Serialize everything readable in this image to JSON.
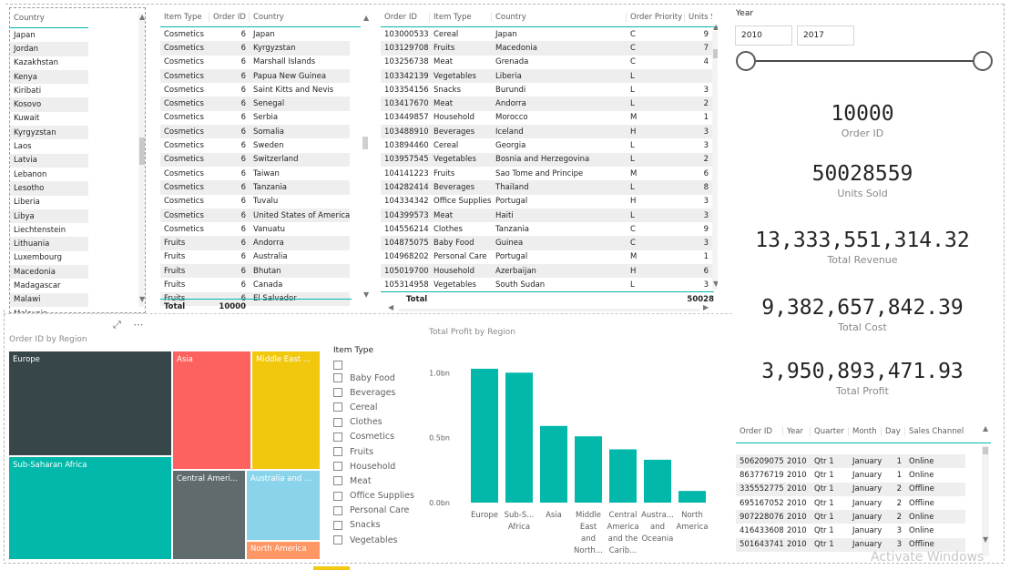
{
  "country_table": {
    "header": "Country",
    "rows": [
      "Japan",
      "Jordan",
      "Kazakhstan",
      "Kenya",
      "Kiribati",
      "Kosovo",
      "Kuwait",
      "Kyrgyzstan",
      "Laos",
      "Latvia",
      "Lebanon",
      "Lesotho",
      "Liberia",
      "Libya",
      "Liechtenstein",
      "Lithuania",
      "Luxembourg",
      "Macedonia",
      "Madagascar",
      "Malawi",
      "Malaysia"
    ]
  },
  "item_table": {
    "headers": [
      "Item Type",
      "Order ID",
      "Country"
    ],
    "rows": [
      [
        "Cosmetics",
        "6",
        "Japan"
      ],
      [
        "Cosmetics",
        "6",
        "Kyrgyzstan"
      ],
      [
        "Cosmetics",
        "6",
        "Marshall Islands"
      ],
      [
        "Cosmetics",
        "6",
        "Papua New Guinea"
      ],
      [
        "Cosmetics",
        "6",
        "Saint Kitts and Nevis"
      ],
      [
        "Cosmetics",
        "6",
        "Senegal"
      ],
      [
        "Cosmetics",
        "6",
        "Serbia"
      ],
      [
        "Cosmetics",
        "6",
        "Somalia"
      ],
      [
        "Cosmetics",
        "6",
        "Sweden"
      ],
      [
        "Cosmetics",
        "6",
        "Switzerland"
      ],
      [
        "Cosmetics",
        "6",
        "Taiwan"
      ],
      [
        "Cosmetics",
        "6",
        "Tanzania"
      ],
      [
        "Cosmetics",
        "6",
        "Tuvalu"
      ],
      [
        "Cosmetics",
        "6",
        "United States of America"
      ],
      [
        "Cosmetics",
        "6",
        "Vanuatu"
      ],
      [
        "Fruits",
        "6",
        "Andorra"
      ],
      [
        "Fruits",
        "6",
        "Australia"
      ],
      [
        "Fruits",
        "6",
        "Bhutan"
      ],
      [
        "Fruits",
        "6",
        "Canada"
      ],
      [
        "Fruits",
        "6",
        "El Salvador"
      ]
    ],
    "total_label": "Total",
    "total_value": "10000"
  },
  "order_table": {
    "headers": [
      "Order ID",
      "Item Type",
      "Country",
      "Order Priority",
      "Units S"
    ],
    "rows": [
      [
        "103000533",
        "Cereal",
        "Japan",
        "C",
        "9"
      ],
      [
        "103129708",
        "Fruits",
        "Macedonia",
        "C",
        "7"
      ],
      [
        "103256738",
        "Meat",
        "Grenada",
        "C",
        "4"
      ],
      [
        "103342139",
        "Vegetables",
        "Liberia",
        "L",
        ""
      ],
      [
        "103354156",
        "Snacks",
        "Burundi",
        "L",
        "3"
      ],
      [
        "103417670",
        "Meat",
        "Andorra",
        "L",
        "2"
      ],
      [
        "103449857",
        "Household",
        "Morocco",
        "M",
        "1"
      ],
      [
        "103488910",
        "Beverages",
        "Iceland",
        "H",
        "3"
      ],
      [
        "103894460",
        "Cereal",
        "Georgia",
        "L",
        "3"
      ],
      [
        "103957545",
        "Vegetables",
        "Bosnia and Herzegovina",
        "L",
        "2"
      ],
      [
        "104141223",
        "Fruits",
        "Sao Tome and Principe",
        "M",
        "6"
      ],
      [
        "104282414",
        "Beverages",
        "Thailand",
        "L",
        "8"
      ],
      [
        "104334342",
        "Office Supplies",
        "Portugal",
        "H",
        "3"
      ],
      [
        "104399573",
        "Meat",
        "Haiti",
        "L",
        "3"
      ],
      [
        "104556214",
        "Clothes",
        "Tanzania",
        "C",
        "9"
      ],
      [
        "104875075",
        "Baby Food",
        "Guinea",
        "C",
        "3"
      ],
      [
        "104968202",
        "Personal Care",
        "Portugal",
        "M",
        "1"
      ],
      [
        "105019700",
        "Household",
        "Azerbaijan",
        "H",
        "6"
      ],
      [
        "105314958",
        "Vegetables",
        "South Sudan",
        "L",
        "3"
      ]
    ],
    "total_label": "Total",
    "total_value": "50028"
  },
  "year_slicer": {
    "title": "Year",
    "from": "2010",
    "to": "2017"
  },
  "kpis": [
    {
      "value": "10000",
      "label": "Order ID"
    },
    {
      "value": "50028559",
      "label": "Units Sold"
    },
    {
      "value": "13,333,551,314.32",
      "label": "Total Revenue"
    },
    {
      "value": "9,382,657,842.39",
      "label": "Total Cost"
    },
    {
      "value": "3,950,893,471.93",
      "label": "Total Profit"
    }
  ],
  "date_table": {
    "headers": [
      "Order ID",
      "Year",
      "Quarter",
      "Month",
      "Day",
      "Sales Channel"
    ],
    "rows": [
      [
        "506209075",
        "2010",
        "Qtr 1",
        "January",
        "1",
        "Online"
      ],
      [
        "863776719",
        "2010",
        "Qtr 1",
        "January",
        "1",
        "Online"
      ],
      [
        "335552775",
        "2010",
        "Qtr 1",
        "January",
        "2",
        "Offline"
      ],
      [
        "695167052",
        "2010",
        "Qtr 1",
        "January",
        "2",
        "Offline"
      ],
      [
        "907228076",
        "2010",
        "Qtr 1",
        "January",
        "2",
        "Online"
      ],
      [
        "416433608",
        "2010",
        "Qtr 1",
        "January",
        "3",
        "Online"
      ],
      [
        "501643741",
        "2010",
        "Qtr 1",
        "January",
        "3",
        "Offline"
      ]
    ]
  },
  "treemap": {
    "title": "Order ID by Region",
    "tiles": [
      {
        "label": "Europe",
        "color": "#374649"
      },
      {
        "label": "Sub-Saharan Africa",
        "color": "#01b8aa"
      },
      {
        "label": "Asia",
        "color": "#fd625e"
      },
      {
        "label": "Middle East ...",
        "color": "#f2c80f"
      },
      {
        "label": "Central Ameri...",
        "color": "#5f6b6d"
      },
      {
        "label": "Australia and ...",
        "color": "#8ad4eb"
      },
      {
        "label": "North America",
        "color": "#fe9666"
      }
    ]
  },
  "item_slicer": {
    "title": "Item Type",
    "items": [
      "Baby Food",
      "Beverages",
      "Cereal",
      "Clothes",
      "Cosmetics",
      "Fruits",
      "Household",
      "Meat",
      "Office Supplies",
      "Personal Care",
      "Snacks",
      "Vegetables"
    ]
  },
  "chart_data": {
    "type": "bar",
    "title": "Total Profit by Region",
    "categories": [
      [
        "Europe"
      ],
      [
        "Sub-S...",
        "Africa"
      ],
      [
        "Asia"
      ],
      [
        "Middle",
        "East",
        "and",
        "North..."
      ],
      [
        "Central",
        "America",
        "and the",
        "Carib..."
      ],
      [
        "Austra...",
        "and",
        "Oceania"
      ],
      [
        "North",
        "America"
      ]
    ],
    "values": [
      1.03,
      1.0,
      0.59,
      0.51,
      0.41,
      0.33,
      0.09
    ],
    "ylim": [
      0,
      1.1
    ],
    "yticks": [
      0,
      0.5,
      1.0
    ],
    "ytick_labels": [
      "0.0bn",
      "0.5bn",
      "1.0bn"
    ],
    "color": "#01b8aa",
    "grid": false
  },
  "watermark": "Activate Windows"
}
